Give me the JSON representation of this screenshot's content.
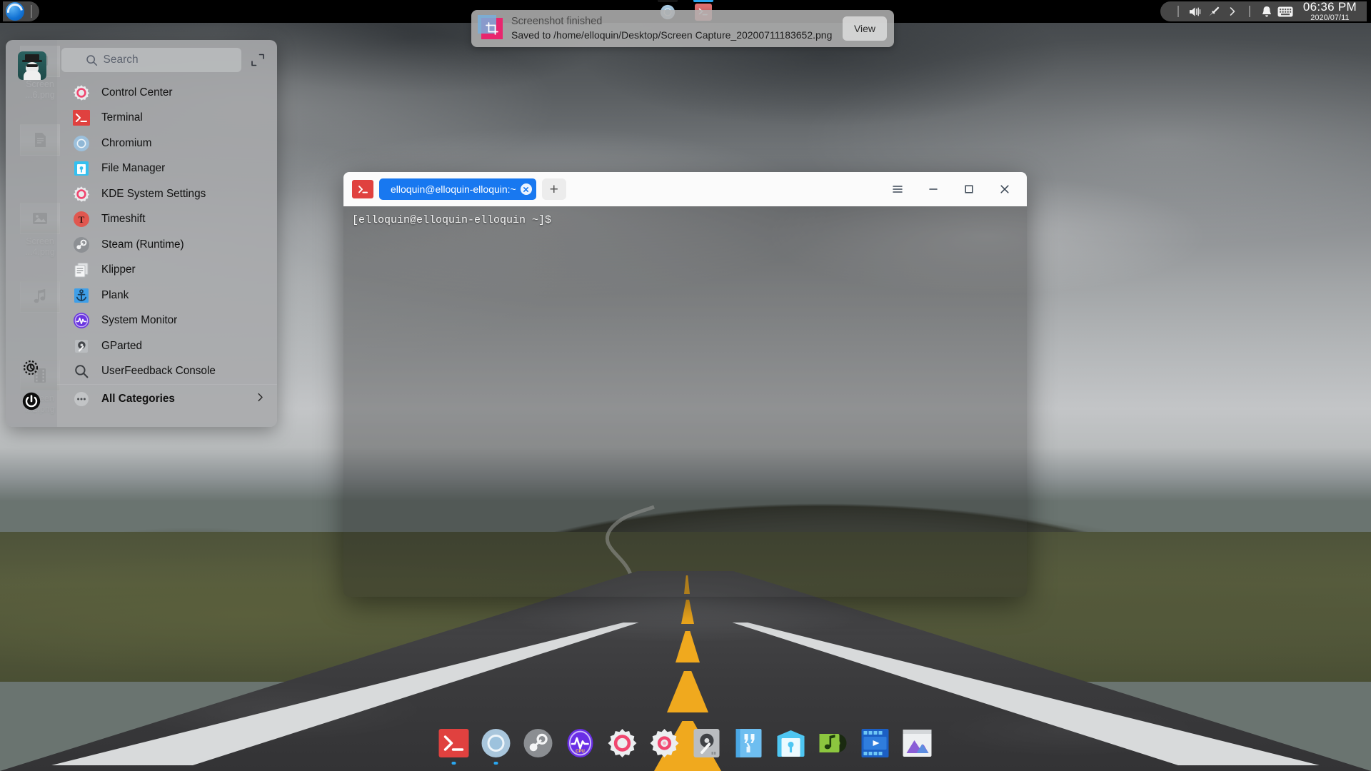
{
  "desktop": {
    "os": "deepin-like linux desktop",
    "wallpaper_description": "grayscale highway road leading to cloudy hills"
  },
  "top_panel": {
    "logo_icon": "deepin-launcher-icon",
    "tasks": [
      {
        "name": "chromium",
        "icon": "chromium-icon",
        "indicator_color": "#1a1a1a",
        "active": false
      },
      {
        "name": "terminal",
        "icon": "terminal-icon",
        "indicator_color": "#2aa7f0",
        "active": true
      }
    ],
    "tray": [
      {
        "name": "volume",
        "icon": "volume-icon"
      },
      {
        "name": "brush",
        "icon": "brush-icon"
      },
      {
        "name": "expand-tray",
        "icon": "chevron-right-icon"
      },
      {
        "name": "notifications",
        "icon": "bell-icon"
      },
      {
        "name": "keyboard-layout",
        "icon": "keyboard-icon"
      }
    ],
    "clock": {
      "time": "06:36 PM",
      "date": "2020/07/11"
    }
  },
  "notification": {
    "icon": "screenshot-crop-icon",
    "title": "Screenshot finished",
    "body": "Saved to /home/elloquin/Desktop/Screen Capture_20200711183652.png",
    "action_label": "View"
  },
  "desktop_icons": [
    {
      "name": "screenshot-file-1",
      "label": "Screen\n...6.png",
      "badge_icon": "monitor-icon"
    },
    {
      "name": "screenshot-file-2",
      "label": "",
      "badge_icon": "document-icon"
    },
    {
      "name": "screenshot-file-3",
      "label": "Screen\n...4.png",
      "badge_icon": "image-icon"
    },
    {
      "name": "screenshot-file-4",
      "label": "",
      "badge_icon": "music-note-icon"
    },
    {
      "name": "screenshot-file-5",
      "label": "Screen\n...2.png",
      "badge_icon": "film-icon"
    }
  ],
  "launcher": {
    "avatar_name": "user-avatar",
    "search": {
      "placeholder": "Search",
      "value": "",
      "icon": "search-icon"
    },
    "expand_icon": "fullscreen-expand-icon",
    "sidebar": [
      {
        "name": "settings",
        "icon": "settings-gear-icon"
      },
      {
        "name": "power",
        "icon": "power-icon"
      }
    ],
    "apps": [
      {
        "label": "Control Center",
        "icon": "control-center-icon"
      },
      {
        "label": "Terminal",
        "icon": "terminal-icon"
      },
      {
        "label": "Chromium",
        "icon": "chromium-icon"
      },
      {
        "label": "File Manager",
        "icon": "file-manager-icon"
      },
      {
        "label": "KDE System Settings",
        "icon": "kde-settings-icon"
      },
      {
        "label": "Timeshift",
        "icon": "timeshift-icon"
      },
      {
        "label": "Steam (Runtime)",
        "icon": "steam-icon"
      },
      {
        "label": "Klipper",
        "icon": "klipper-icon"
      },
      {
        "label": "Plank",
        "icon": "plank-anchor-icon"
      },
      {
        "label": "System Monitor",
        "icon": "system-monitor-icon"
      },
      {
        "label": "GParted",
        "icon": "gparted-icon"
      },
      {
        "label": "UserFeedback Console",
        "icon": "magnifier-icon"
      }
    ],
    "all_categories": {
      "label": "All Categories",
      "icon": "ellipsis-icon",
      "chevron": "chevron-right-icon"
    }
  },
  "terminal_window": {
    "app_icon": "terminal-icon",
    "tab": {
      "label": "elloquin@elloquin-elloquin:~",
      "close_icon": "close-icon"
    },
    "new_tab_label": "+",
    "window_buttons": [
      {
        "name": "menu",
        "icon": "hamburger-menu-icon"
      },
      {
        "name": "minimize",
        "icon": "minimize-icon"
      },
      {
        "name": "maximize",
        "icon": "maximize-icon"
      },
      {
        "name": "close",
        "icon": "close-icon"
      }
    ],
    "content": "[elloquin@elloquin-elloquin ~]$"
  },
  "dock": {
    "items": [
      {
        "name": "terminal",
        "icon": "terminal-icon",
        "running": true
      },
      {
        "name": "chromium",
        "icon": "chromium-icon",
        "running": true
      },
      {
        "name": "steam",
        "icon": "steam-icon",
        "running": false
      },
      {
        "name": "system-monitor",
        "icon": "system-monitor-icon",
        "running": false
      },
      {
        "name": "control-center",
        "icon": "control-center-icon",
        "running": false
      },
      {
        "name": "kde-settings",
        "icon": "kde-settings-icon",
        "running": false
      },
      {
        "name": "gparted",
        "icon": "gparted-icon",
        "running": false
      },
      {
        "name": "text-editor",
        "icon": "text-editor-icon",
        "running": false
      },
      {
        "name": "file-manager",
        "icon": "file-manager-icon",
        "running": false
      },
      {
        "name": "music-player",
        "icon": "music-player-icon",
        "running": false
      },
      {
        "name": "video-player",
        "icon": "video-player-icon",
        "running": false
      },
      {
        "name": "image-viewer",
        "icon": "image-viewer-icon",
        "running": false
      }
    ]
  },
  "colors": {
    "accent_blue": "#1878f0",
    "terminal_red": "#e0413f",
    "notification_pink": "#e8266e",
    "road_yellow": "#f0a91e",
    "indicator_blue": "#2aa7f0"
  }
}
